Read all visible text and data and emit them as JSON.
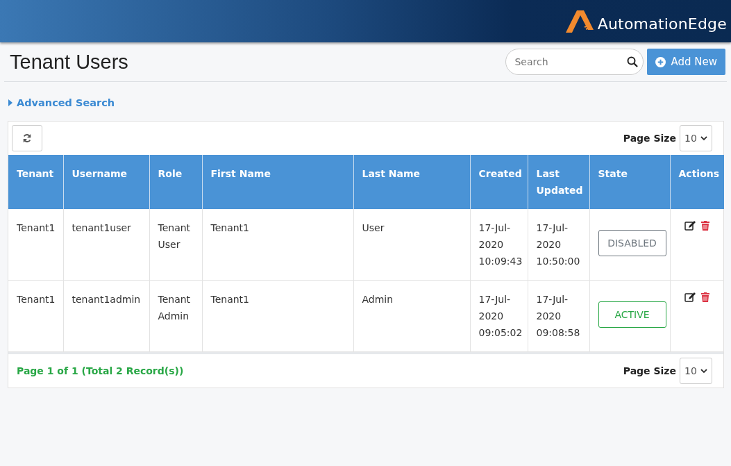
{
  "header": {
    "brand": "AutomationEdge"
  },
  "page": {
    "title": "Tenant Users",
    "search": {
      "placeholder": "Search"
    },
    "add_button": "Add New"
  },
  "advanced_search": {
    "label": "Advanced Search",
    "expanded": false
  },
  "table": {
    "page_size_label": "Page Size",
    "page_size": "10",
    "columns": [
      "Tenant",
      "Username",
      "Role",
      "First Name",
      "Last Name",
      "Created",
      "Last Updated",
      "State",
      "Actions"
    ],
    "rows": [
      {
        "tenant": "Tenant1",
        "username": "tenant1user",
        "role": "Tenant User",
        "first_name": "Tenant1",
        "last_name": "User",
        "created": "17-Jul-2020 10:09:43",
        "last_updated": "17-Jul-2020 10:50:00",
        "state": {
          "label": "DISABLED",
          "kind": "disabled"
        }
      },
      {
        "tenant": "Tenant1",
        "username": "tenant1admin",
        "role": "Tenant Admin",
        "first_name": "Tenant1",
        "last_name": "Admin",
        "created": "17-Jul-2020 09:05:02",
        "last_updated": "17-Jul-2020 09:08:58",
        "state": {
          "label": "ACTIVE",
          "kind": "active"
        }
      }
    ]
  },
  "footer": {
    "summary": "Page 1 of 1 (Total 2 Record(s))",
    "page_size_label": "Page Size",
    "page_size": "10"
  }
}
